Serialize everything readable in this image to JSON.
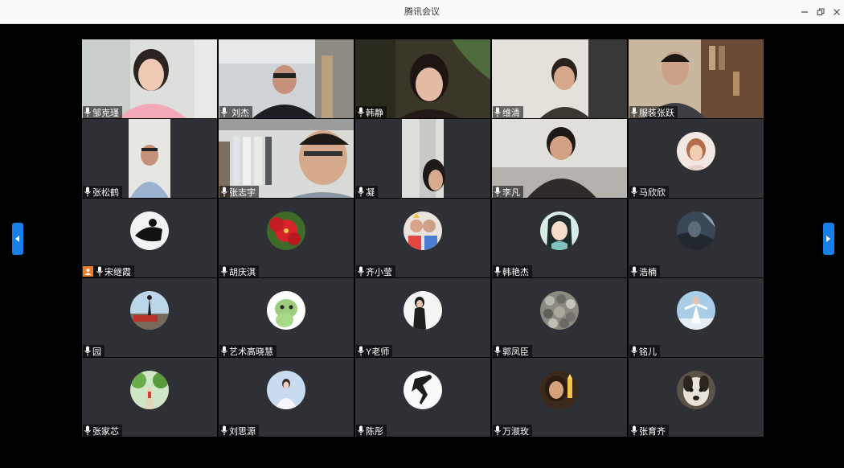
{
  "window": {
    "title": "腾讯会议"
  },
  "participants": [
    {
      "name": "邹克瑾",
      "video": true
    },
    {
      "name": " 刘杰",
      "video": true
    },
    {
      "name": "韩静",
      "video": true,
      "active": true
    },
    {
      "name": "维清",
      "video": true
    },
    {
      "name": "服装张跃",
      "video": true
    },
    {
      "name": "张松鹤",
      "video": true
    },
    {
      "name": "张志宇",
      "video": true
    },
    {
      "name": "凝",
      "video": true
    },
    {
      "name": "李凡",
      "video": true
    },
    {
      "name": "马欣欣",
      "video": false
    },
    {
      "name": "宋继霞",
      "video": false,
      "host": true
    },
    {
      "name": "胡庆淇",
      "video": false
    },
    {
      "name": "齐小莹",
      "video": false
    },
    {
      "name": "韩艳杰",
      "video": false
    },
    {
      "name": "浩楠",
      "video": false
    },
    {
      "name": "园",
      "video": false
    },
    {
      "name": "艺术高晓慧",
      "video": false
    },
    {
      "name": "Y老师",
      "video": false
    },
    {
      "name": "郭凤臣",
      "video": false
    },
    {
      "name": "铭儿",
      "video": false
    },
    {
      "name": "张家芯",
      "video": false
    },
    {
      "name": "刘思源",
      "video": false
    },
    {
      "name": "陈彤",
      "video": false
    },
    {
      "name": "万淑玫",
      "video": false
    },
    {
      "name": "张育齐",
      "video": false
    }
  ],
  "colors": {
    "tile_bg": "#2e3035",
    "active_border": "#28b561",
    "nav_button": "#1a7ee8",
    "host_badge": "#f07b22"
  },
  "icons": {
    "mic": "microphone-icon",
    "prev": "chevron-left-icon",
    "next": "chevron-right-icon"
  }
}
